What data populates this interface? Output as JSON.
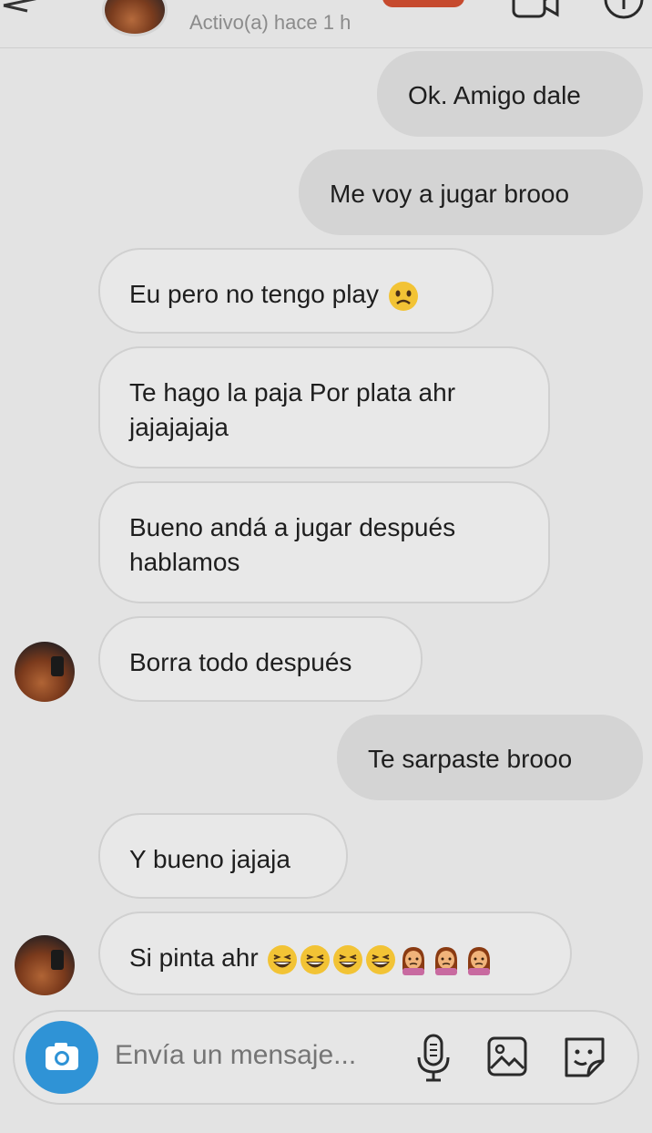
{
  "header": {
    "status": "Activo(a) hace 1 h"
  },
  "messages": [
    {
      "side": "out",
      "text": "Ok. Amigo dale"
    },
    {
      "side": "out",
      "text": "Me voy a jugar brooo"
    },
    {
      "side": "in",
      "text": "Eu pero no tengo play",
      "emoji": "worried-face"
    },
    {
      "side": "in",
      "line1": "Te hago la paja Por plata ahr",
      "line2": "jajajajaja"
    },
    {
      "side": "in",
      "line1": "Bueno andá a jugar después",
      "line2": "hablamos"
    },
    {
      "side": "in",
      "text": "Borra todo después"
    },
    {
      "side": "out",
      "text": "Te sarpaste brooo"
    },
    {
      "side": "in",
      "text": "Y bueno jajaja"
    },
    {
      "side": "in",
      "text": "Si pinta ahr",
      "emojis": [
        "grinning-squinting-face",
        "grinning-squinting-face",
        "grinning-squinting-face",
        "grinning-squinting-face",
        "woman-pouting",
        "woman-pouting",
        "woman-pouting"
      ]
    }
  ],
  "composer": {
    "placeholder": "Envía un mensaje..."
  },
  "colors": {
    "background": "#e3e3e3",
    "outgoing_bubble": "#d4d4d4",
    "incoming_bubble": "#e8e8e8",
    "camera_button": "#2f93d6"
  }
}
